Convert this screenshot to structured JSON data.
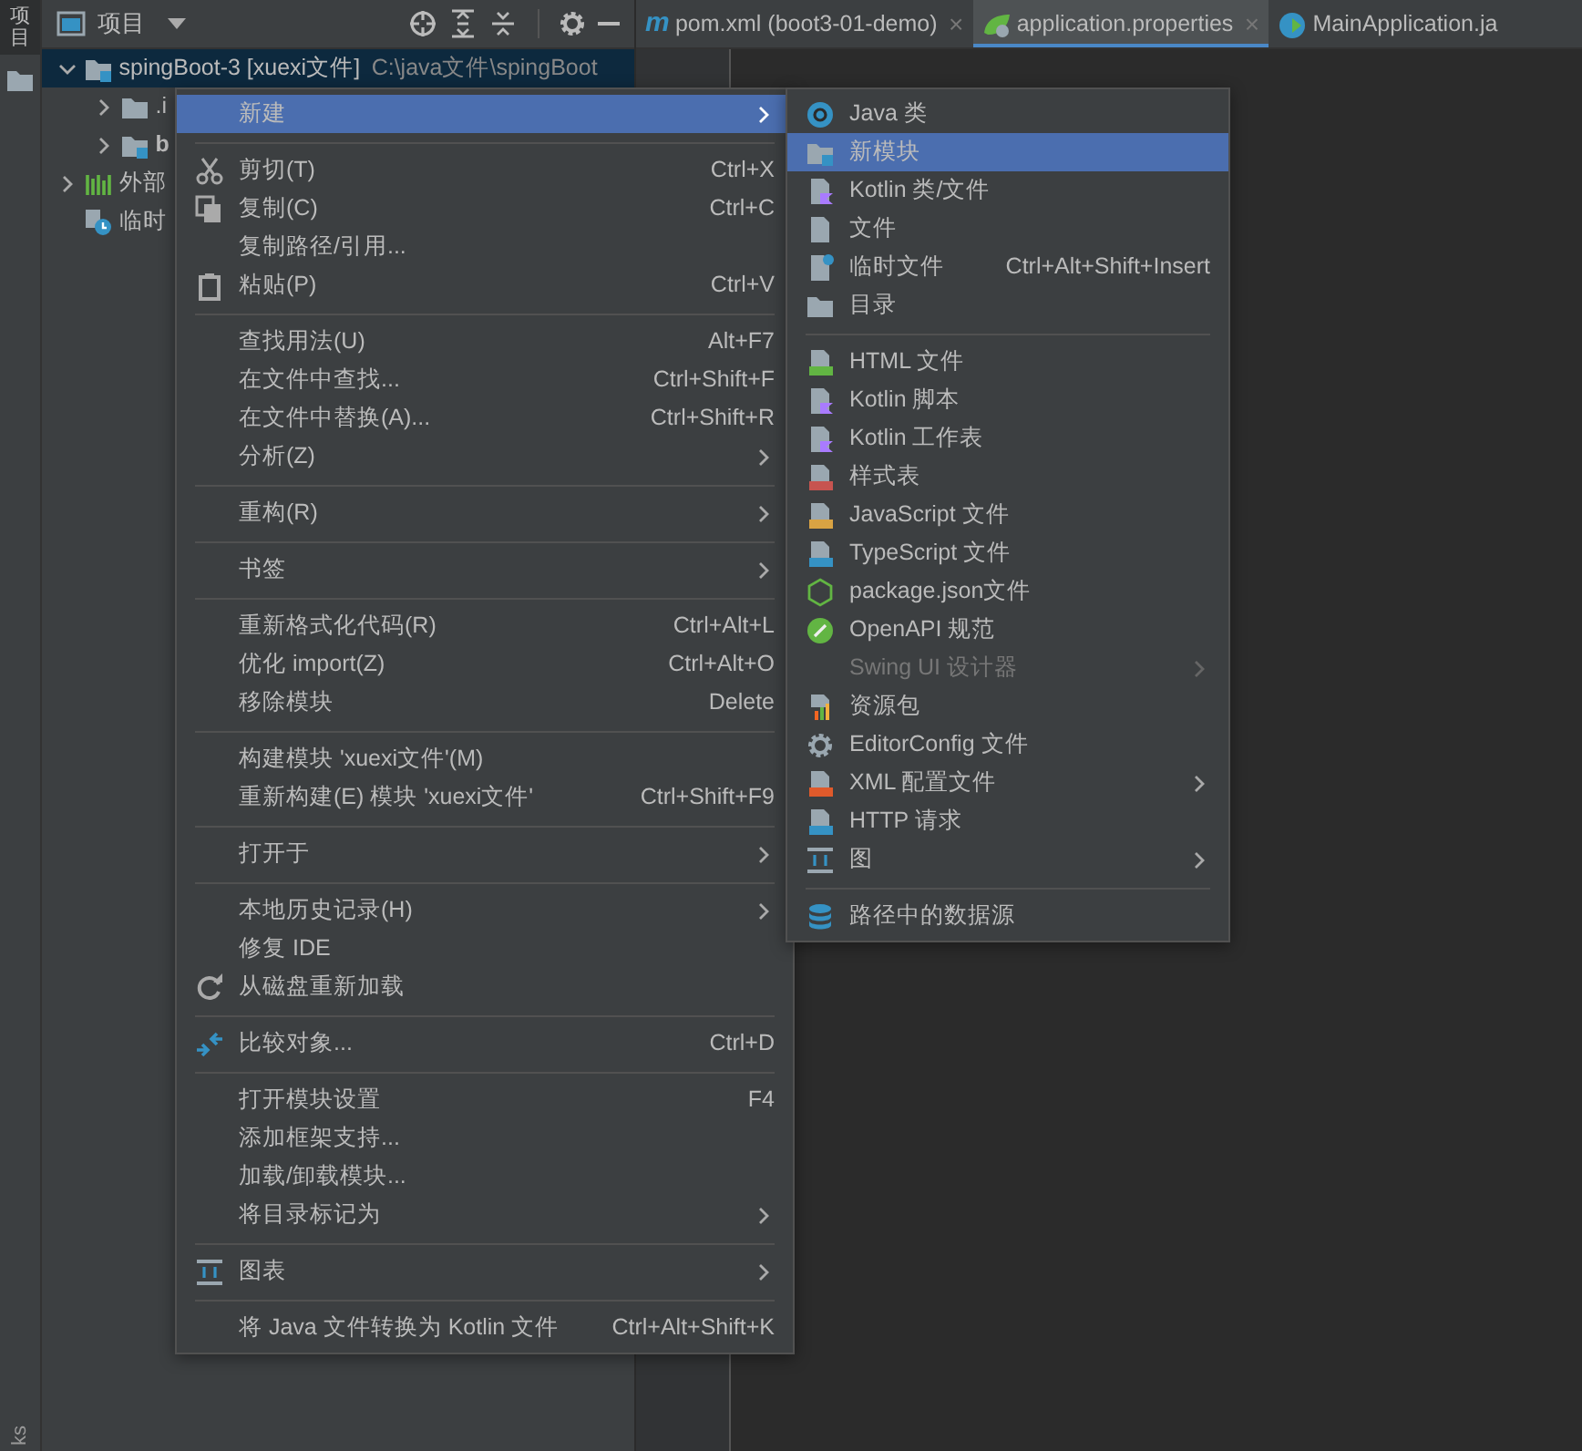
{
  "tool_stripe": {
    "tab_label": "项目",
    "bottom_label": "ks"
  },
  "project_panel": {
    "title": "项目",
    "tree": [
      {
        "label": "spingBoot-3 [xuexi文件]",
        "path": "C:\\java文件\\spingBoot",
        "expanded": true,
        "selected": true,
        "children": [
          {
            "label": ".i",
            "expanded": false,
            "selected": false
          },
          {
            "label": "b",
            "expanded": false,
            "selected": false
          }
        ]
      },
      {
        "label": "外部",
        "expanded": false,
        "selected": false
      },
      {
        "label": "临时",
        "selected": false
      }
    ]
  },
  "editor_tabs": [
    {
      "icon_text": "m",
      "label": "pom.xml (boot3-01-demo)",
      "close": "×",
      "selected": false
    },
    {
      "label": "application.properties",
      "close": "×",
      "selected": true
    },
    {
      "label": "MainApplication.ja",
      "selected": false
    }
  ],
  "menu": {
    "items": [
      {
        "kind": "item",
        "label": "新建",
        "submenu": true,
        "selected": true
      },
      {
        "kind": "separator"
      },
      {
        "kind": "item",
        "label": "剪切(T)",
        "shortcut": "Ctrl+X",
        "selected": false
      },
      {
        "kind": "item",
        "label": "复制(C)",
        "shortcut": "Ctrl+C",
        "selected": false
      },
      {
        "kind": "item",
        "label": "复制路径/引用...",
        "selected": false
      },
      {
        "kind": "item",
        "label": "粘贴(P)",
        "shortcut": "Ctrl+V",
        "selected": false
      },
      {
        "kind": "separator"
      },
      {
        "kind": "item",
        "label": "查找用法(U)",
        "shortcut": "Alt+F7",
        "selected": false
      },
      {
        "kind": "item",
        "label": "在文件中查找...",
        "shortcut": "Ctrl+Shift+F",
        "selected": false
      },
      {
        "kind": "item",
        "label": "在文件中替换(A)...",
        "shortcut": "Ctrl+Shift+R",
        "selected": false
      },
      {
        "kind": "item",
        "label": "分析(Z)",
        "submenu": true,
        "selected": false
      },
      {
        "kind": "separator"
      },
      {
        "kind": "item",
        "label": "重构(R)",
        "submenu": true,
        "selected": false
      },
      {
        "kind": "separator"
      },
      {
        "kind": "item",
        "label": "书签",
        "submenu": true,
        "selected": false
      },
      {
        "kind": "separator"
      },
      {
        "kind": "item",
        "label": "重新格式化代码(R)",
        "shortcut": "Ctrl+Alt+L",
        "selected": false
      },
      {
        "kind": "item",
        "label": "优化 import(Z)",
        "shortcut": "Ctrl+Alt+O",
        "selected": false
      },
      {
        "kind": "item",
        "label": "移除模块",
        "shortcut": "Delete",
        "selected": false
      },
      {
        "kind": "separator"
      },
      {
        "kind": "item",
        "label": "构建模块 'xuexi文件'(M)",
        "selected": false
      },
      {
        "kind": "item",
        "label": "重新构建(E) 模块 'xuexi文件'",
        "shortcut": "Ctrl+Shift+F9",
        "selected": false
      },
      {
        "kind": "separator"
      },
      {
        "kind": "item",
        "label": "打开于",
        "submenu": true,
        "selected": false
      },
      {
        "kind": "separator"
      },
      {
        "kind": "item",
        "label": "本地历史记录(H)",
        "submenu": true,
        "selected": false
      },
      {
        "kind": "item",
        "label": "修复 IDE",
        "selected": false
      },
      {
        "kind": "item",
        "label": "从磁盘重新加载",
        "selected": false
      },
      {
        "kind": "separator"
      },
      {
        "kind": "item",
        "label": "比较对象...",
        "shortcut": "Ctrl+D",
        "selected": false
      },
      {
        "kind": "separator"
      },
      {
        "kind": "item",
        "label": "打开模块设置",
        "shortcut": "F4",
        "selected": false
      },
      {
        "kind": "item",
        "label": "添加框架支持...",
        "selected": false
      },
      {
        "kind": "item",
        "label": "加载/卸载模块...",
        "selected": false
      },
      {
        "kind": "item",
        "label": "将目录标记为",
        "submenu": true,
        "selected": false
      },
      {
        "kind": "separator"
      },
      {
        "kind": "item",
        "label": "图表",
        "submenu": true,
        "selected": false
      },
      {
        "kind": "separator"
      },
      {
        "kind": "item",
        "label": "将 Java 文件转换为 Kotlin 文件",
        "shortcut": "Ctrl+Alt+Shift+K",
        "selected": false
      }
    ]
  },
  "submenu": {
    "items": [
      {
        "kind": "item",
        "label": "Java 类",
        "selected": false
      },
      {
        "kind": "item",
        "label": "新模块",
        "selected": true
      },
      {
        "kind": "item",
        "label": "Kotlin 类/文件",
        "selected": false
      },
      {
        "kind": "item",
        "label": "文件",
        "selected": false
      },
      {
        "kind": "item",
        "label": "临时文件",
        "shortcut": "Ctrl+Alt+Shift+Insert",
        "selected": false
      },
      {
        "kind": "item",
        "label": "目录",
        "selected": false
      },
      {
        "kind": "separator"
      },
      {
        "kind": "item",
        "label": "HTML 文件",
        "selected": false
      },
      {
        "kind": "item",
        "label": "Kotlin 脚本",
        "selected": false
      },
      {
        "kind": "item",
        "label": "Kotlin 工作表",
        "selected": false
      },
      {
        "kind": "item",
        "label": "样式表",
        "selected": false
      },
      {
        "kind": "item",
        "label": "JavaScript 文件",
        "selected": false
      },
      {
        "kind": "item",
        "label": "TypeScript 文件",
        "selected": false
      },
      {
        "kind": "item",
        "label": "package.json文件",
        "selected": false
      },
      {
        "kind": "item",
        "label": "OpenAPI 规范",
        "selected": false
      },
      {
        "kind": "item",
        "label": "Swing UI 设计器",
        "submenu": true,
        "disabled": true,
        "selected": false
      },
      {
        "kind": "item",
        "label": "资源包",
        "selected": false
      },
      {
        "kind": "item",
        "label": "EditorConfig 文件",
        "selected": false
      },
      {
        "kind": "item",
        "label": "XML 配置文件",
        "submenu": true,
        "selected": false
      },
      {
        "kind": "item",
        "label": "HTTP 请求",
        "selected": false
      },
      {
        "kind": "item",
        "label": "图",
        "submenu": true,
        "selected": false
      },
      {
        "kind": "separator"
      },
      {
        "kind": "item",
        "label": "路径中的数据源",
        "selected": false
      }
    ]
  }
}
